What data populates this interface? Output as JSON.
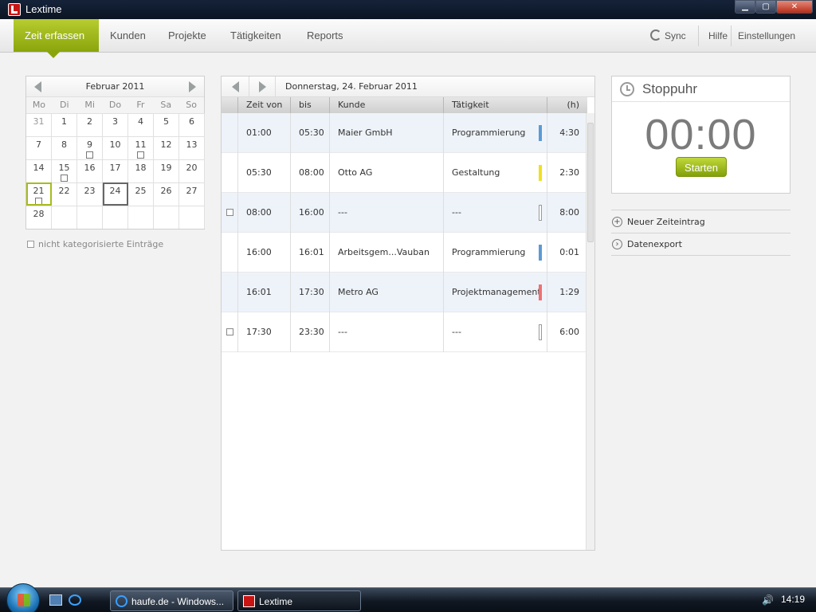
{
  "window": {
    "title": "Lextime",
    "minimize": "▁",
    "maximize": "▢",
    "close": "✕"
  },
  "nav": {
    "tabs": [
      {
        "label": "Zeit erfassen",
        "active": true
      },
      {
        "label": "Kunden"
      },
      {
        "label": "Projekte"
      },
      {
        "label": "Tätigkeiten"
      },
      {
        "label": "Reports"
      }
    ],
    "sync": "Sync",
    "help": "Hilfe",
    "settings": "Einstellungen"
  },
  "calendar": {
    "month": "Februar 2011",
    "weekdays": [
      "Mo",
      "Di",
      "Mi",
      "Do",
      "Fr",
      "Sa",
      "So"
    ],
    "days": [
      "31",
      "1",
      "2",
      "3",
      "4",
      "5",
      "6",
      "7",
      "8",
      "9",
      "10",
      "11",
      "12",
      "13",
      "14",
      "15",
      "16",
      "17",
      "18",
      "19",
      "20",
      "21",
      "22",
      "23",
      "24",
      "25",
      "26",
      "27",
      "28"
    ],
    "muted_days": [
      "31"
    ],
    "flagged_days": [
      "9",
      "11",
      "15",
      "21"
    ],
    "today": "21",
    "selected": "24",
    "uncategorized_label": "nicht kategorisierte Einträge"
  },
  "entries": {
    "date": "Donnerstag, 24. Februar 2011",
    "columns": {
      "from": "Zeit von ▼",
      "to": "bis",
      "customer": "Kunde",
      "activity": "Tätigkeit",
      "hours": "(h)"
    },
    "rows": [
      {
        "check": false,
        "from": "01:00",
        "to": "05:30",
        "customer": "Maier GmbH",
        "activity": "Programmierung",
        "color": "#5b9bd5",
        "hours": "4:30"
      },
      {
        "check": false,
        "from": "05:30",
        "to": "08:00",
        "customer": "Otto AG",
        "activity": "Gestaltung",
        "color": "#f0e020",
        "hours": "2:30"
      },
      {
        "check": true,
        "from": "08:00",
        "to": "16:00",
        "customer": "---",
        "activity": "---",
        "color": "",
        "hours": "8:00"
      },
      {
        "check": false,
        "from": "16:00",
        "to": "16:01",
        "customer": "Arbeitsgem...Vauban",
        "activity": "Programmierung",
        "color": "#5b9bd5",
        "hours": "0:01"
      },
      {
        "check": false,
        "from": "16:01",
        "to": "17:30",
        "customer": "Metro AG",
        "activity": "Projektmanagement",
        "color": "#f07070",
        "hours": "1:29"
      },
      {
        "check": true,
        "from": "17:30",
        "to": "23:30",
        "customer": "---",
        "activity": "---",
        "color": "",
        "hours": "6:00"
      }
    ]
  },
  "stopwatch": {
    "title": "Stoppuhr",
    "time": "00:00",
    "start": "Starten"
  },
  "actions": [
    {
      "icon": "plus-circle-icon",
      "label": "Neuer Zeiteintrag"
    },
    {
      "icon": "arrow-circle-icon",
      "label": "Datenexport"
    }
  ],
  "taskbar": {
    "items": [
      {
        "label": "haufe.de - Windows..."
      },
      {
        "label": "Lextime"
      }
    ],
    "time": "14:19"
  }
}
